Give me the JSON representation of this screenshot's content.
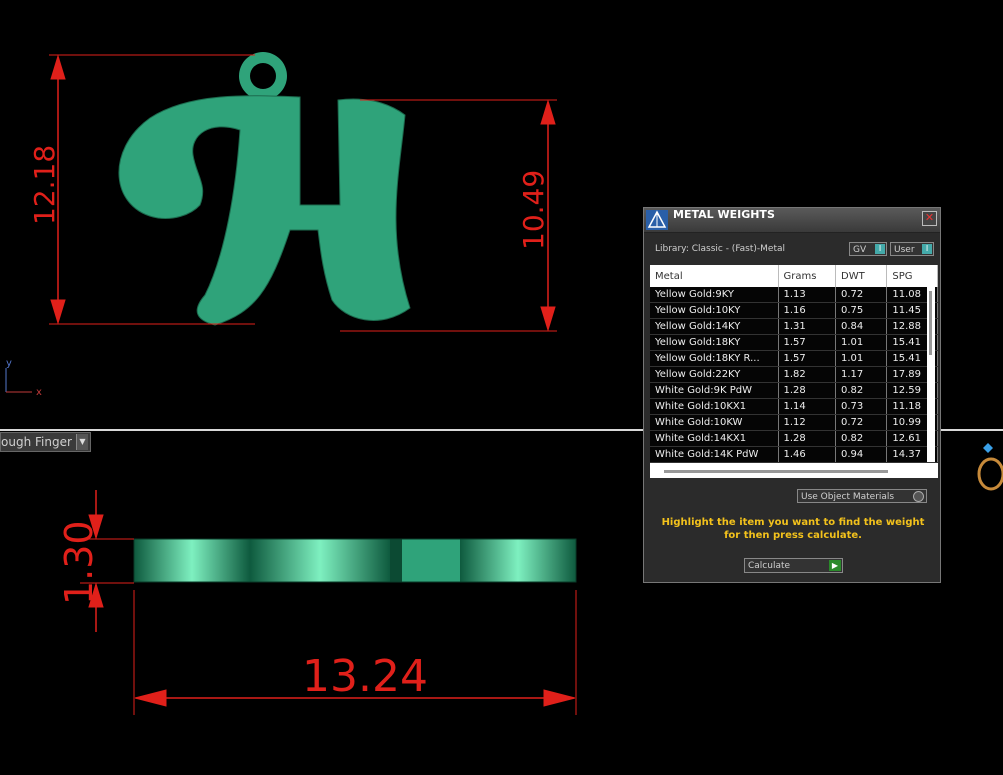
{
  "view_top": {
    "dim_height_left": "12.18",
    "dim_height_right": "10.49",
    "axis_y": "y",
    "axis_x": "x"
  },
  "view_bottom": {
    "label": "ough Finger",
    "dim_thickness": "1.30",
    "dim_width": "13.24"
  },
  "metal_panel": {
    "title": "METAL WEIGHTS",
    "close_glyph": "✕",
    "library_label": "Library: Classic - (Fast)-Metal",
    "toggle_gv": "GV",
    "toggle_user": "User",
    "columns": [
      "Metal",
      "Grams",
      "DWT",
      "SPG"
    ],
    "rows": [
      [
        "Yellow Gold:9KY",
        "1.13",
        "0.72",
        "11.08"
      ],
      [
        "Yellow Gold:10KY",
        "1.16",
        "0.75",
        "11.45"
      ],
      [
        "Yellow Gold:14KY",
        "1.31",
        "0.84",
        "12.88"
      ],
      [
        "Yellow Gold:18KY",
        "1.57",
        "1.01",
        "15.41"
      ],
      [
        "Yellow Gold:18KY R...",
        "1.57",
        "1.01",
        "15.41"
      ],
      [
        "Yellow Gold:22KY",
        "1.82",
        "1.17",
        "17.89"
      ],
      [
        "White Gold:9K PdW",
        "1.28",
        "0.82",
        "12.59"
      ],
      [
        "White Gold:10KX1",
        "1.14",
        "0.73",
        "11.18"
      ],
      [
        "White Gold:10KW",
        "1.12",
        "0.72",
        "10.99"
      ],
      [
        "White Gold:14KX1",
        "1.28",
        "0.82",
        "12.61"
      ],
      [
        "White Gold:14K PdW",
        "1.46",
        "0.94",
        "14.37"
      ]
    ],
    "use_object_materials": "Use Object Materials",
    "hint_line1": "Highlight the item you want to find the weight",
    "hint_line2": "for then press calculate.",
    "calculate_label": "Calculate"
  },
  "colors": {
    "dimension": "#e0201a",
    "model_green": "#2fa37a",
    "hint": "#f3c21c"
  }
}
